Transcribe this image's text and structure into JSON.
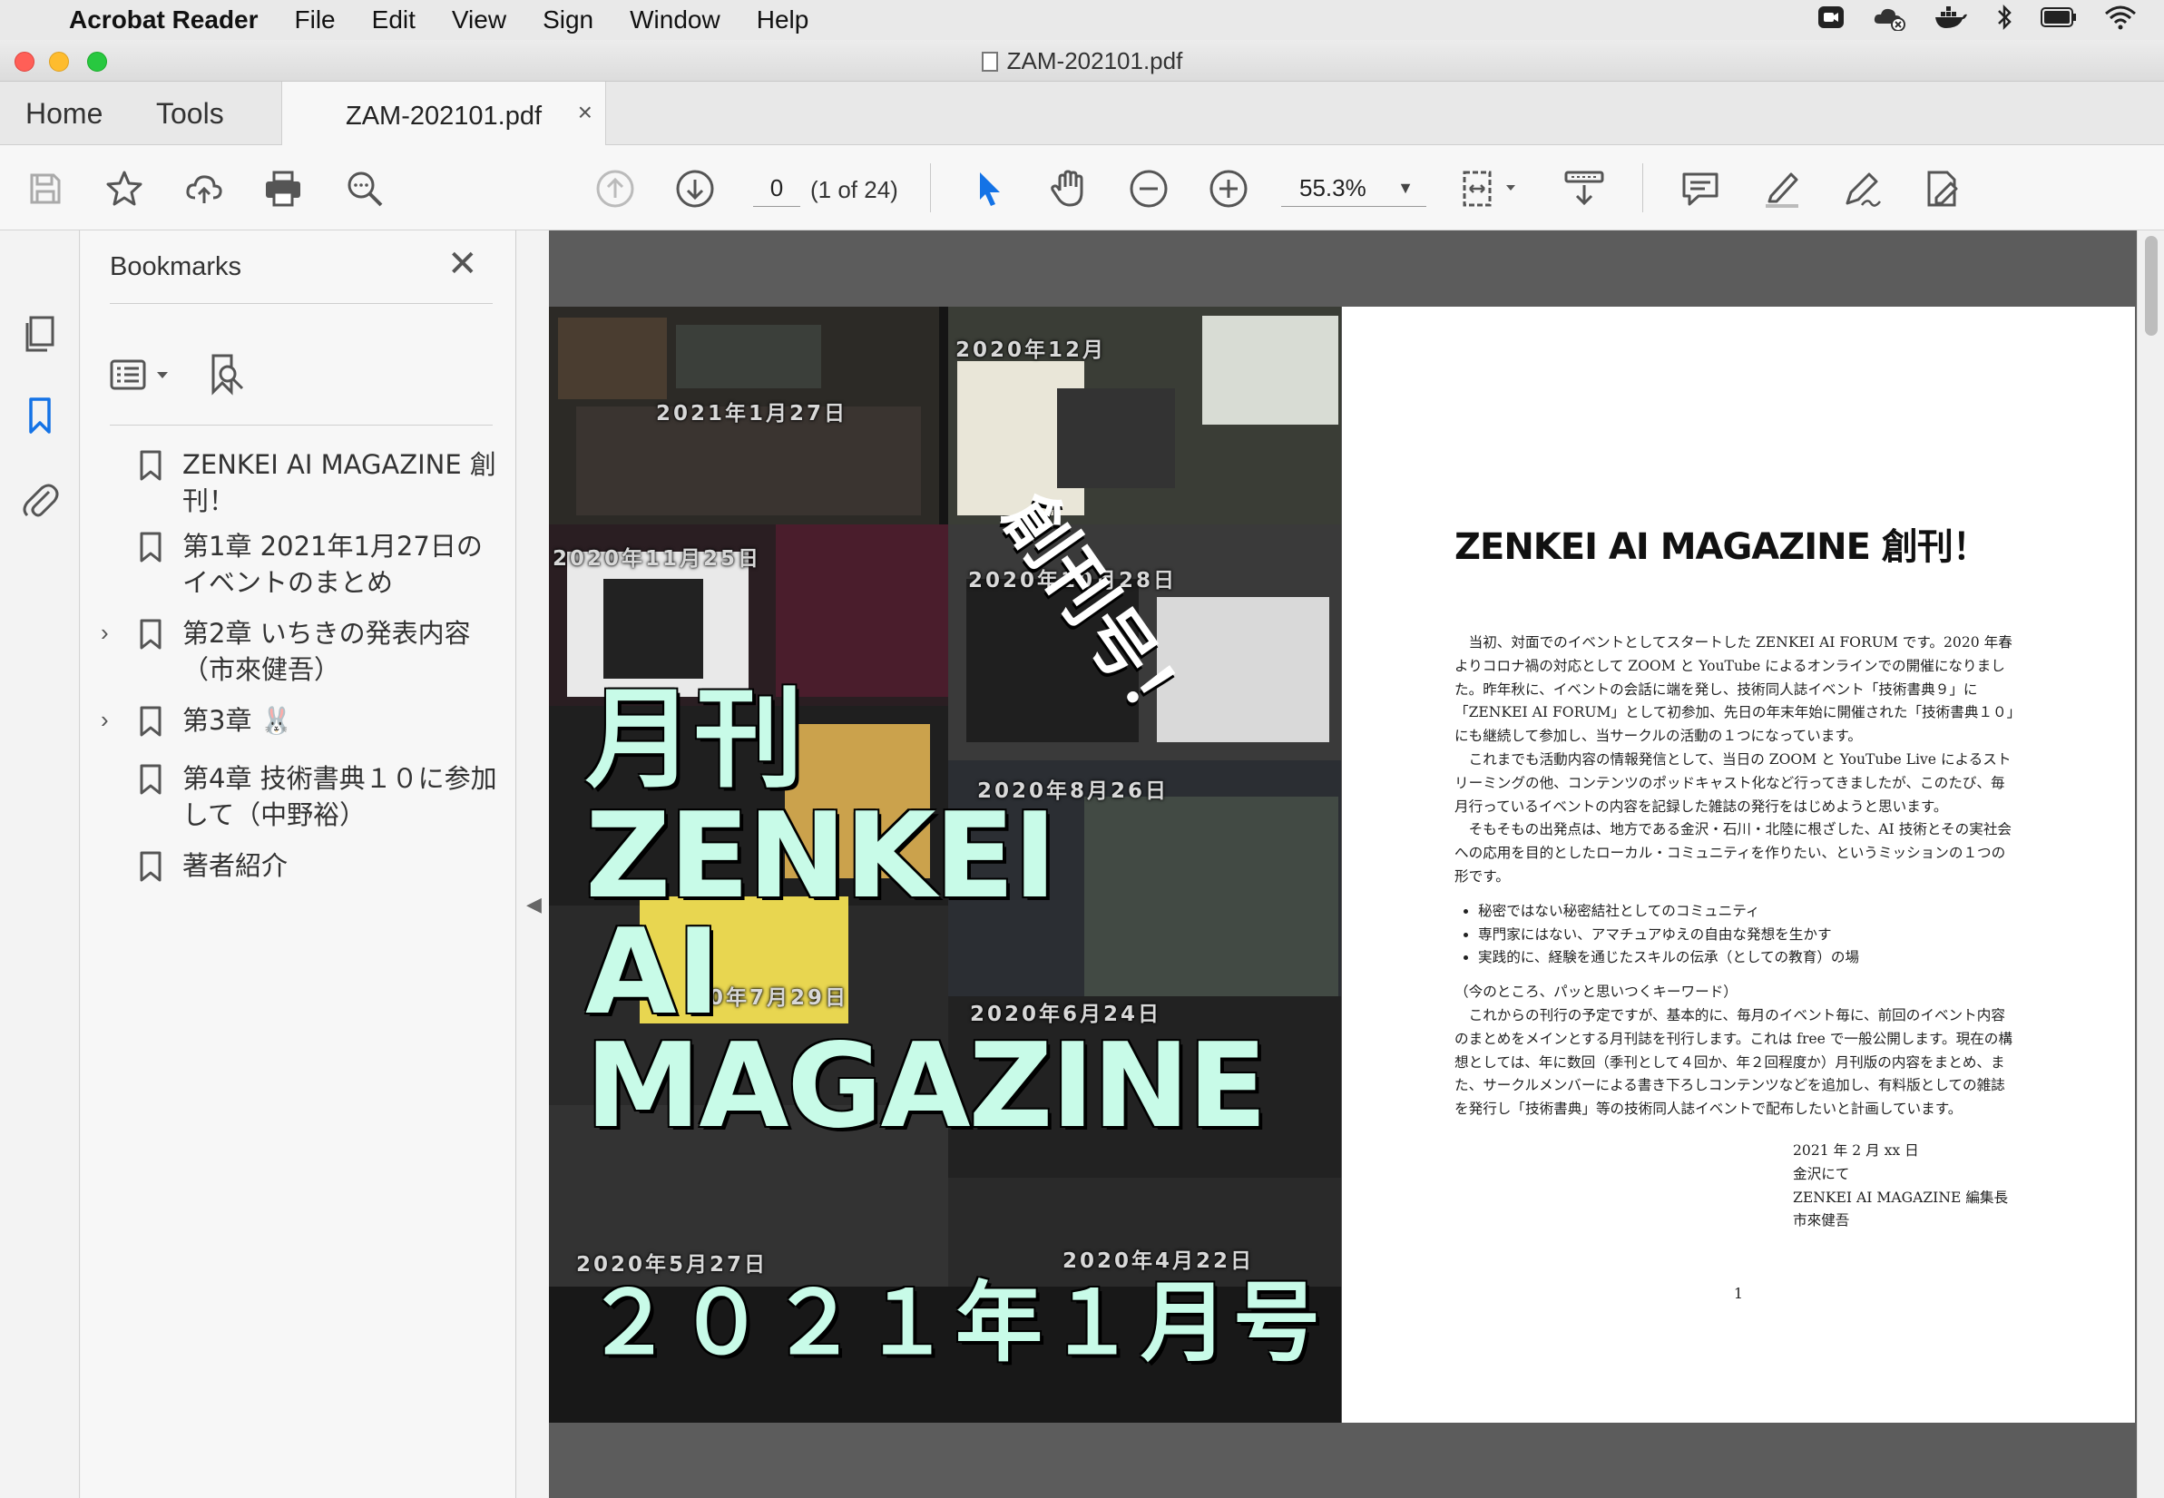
{
  "menubar": {
    "app_name": "Acrobat Reader",
    "items": [
      "File",
      "Edit",
      "View",
      "Sign",
      "Window",
      "Help"
    ]
  },
  "window": {
    "title": "ZAM-202101.pdf"
  },
  "tabs": {
    "home": "Home",
    "tools": "Tools",
    "document": "ZAM-202101.pdf",
    "close": "×"
  },
  "toolbar": {
    "page_number": "0",
    "page_of": "(1 of 24)",
    "zoom": "55.3%"
  },
  "bookmarks": {
    "title": "Bookmarks",
    "close": "✕",
    "items": [
      {
        "label": "ZENKEI AI MAGAZINE 創刊！",
        "expandable": false
      },
      {
        "label": "第1章 2021年1月27日のイベントのまとめ",
        "expandable": false
      },
      {
        "label": "第2章 いちきの発表内容（市來健吾）",
        "expandable": true
      },
      {
        "label": "第3章 🐰",
        "expandable": true
      },
      {
        "label": "第4章 技術書典１０に参加して（中野裕）",
        "expandable": false
      },
      {
        "label": "著者紹介",
        "expandable": false
      }
    ]
  },
  "cover": {
    "sokan": "創刊号！",
    "gekkan": "月刊",
    "zenkei": "ZENKEI",
    "ai": "AI",
    "magazine": "MAGAZINE",
    "issue": "２０２１年１月号",
    "dates": [
      "2021年1月27日",
      "2020年12月",
      "2020年11月25日",
      "2020年10月28日",
      "2020年8月26日",
      "0年7月29日",
      "2020年6月24日",
      "2020年5月27日",
      "2020年4月22日"
    ]
  },
  "textpage": {
    "title": "ZENKEI AI MAGAZINE 創刊！",
    "p1": "当初、対面でのイベントとしてスタートした ZENKEI AI FORUM です。2020 年春よりコロナ禍の対応として ZOOM と YouTube によるオンラインでの開催になりました。昨年秋に、イベントの会話に端を発し、技術同人誌イベント「技術書典９」に「ZENKEI AI FORUM」として初参加、先日の年末年始に開催された「技術書典１０」にも継続して参加し、当サークルの活動の１つになっています。",
    "p2": "これまでも活動内容の情報発信として、当日の ZOOM と YouTube Live によるストリーミングの他、コンテンツのポッドキャスト化など行ってきましたが、このたび、毎月行っているイベントの内容を記録した雑誌の発行をはじめようと思います。",
    "p3": "そもそもの出発点は、地方である金沢・石川・北陸に根ざした、AI 技術とその実社会への応用を目的としたローカル・コミュニティを作りたい、というミッションの１つの形です。",
    "bullets": [
      "秘密ではない秘密結社としてのコミュニティ",
      "専門家にはない、アマチュアゆえの自由な発想を生かす",
      "実践的に、経験を通じたスキルの伝承（としての教育）の場"
    ],
    "keyword_note": "（今のところ、パッと思いつくキーワード）",
    "p4": "これからの刊行の予定ですが、基本的に、毎月のイベント毎に、前回のイベント内容のまとめをメインとする月刊誌を刊行します。これは free で一般公開します。現在の構想としては、年に数回（季刊として４回か、年２回程度か）月刊版の内容をまとめ、また、サークルメンバーによる書き下ろしコンテンツなどを追加し、有料版としての雑誌を発行し「技術書典」等の技術同人誌イベントで配布したいと計画しています。",
    "sign_date": "2021 年 2 月 xx 日",
    "sign_place": "金沢にて",
    "sign_role": "ZENKEI AI MAGAZINE 編集長",
    "sign_name": "市來健吾",
    "page_number": "1"
  }
}
